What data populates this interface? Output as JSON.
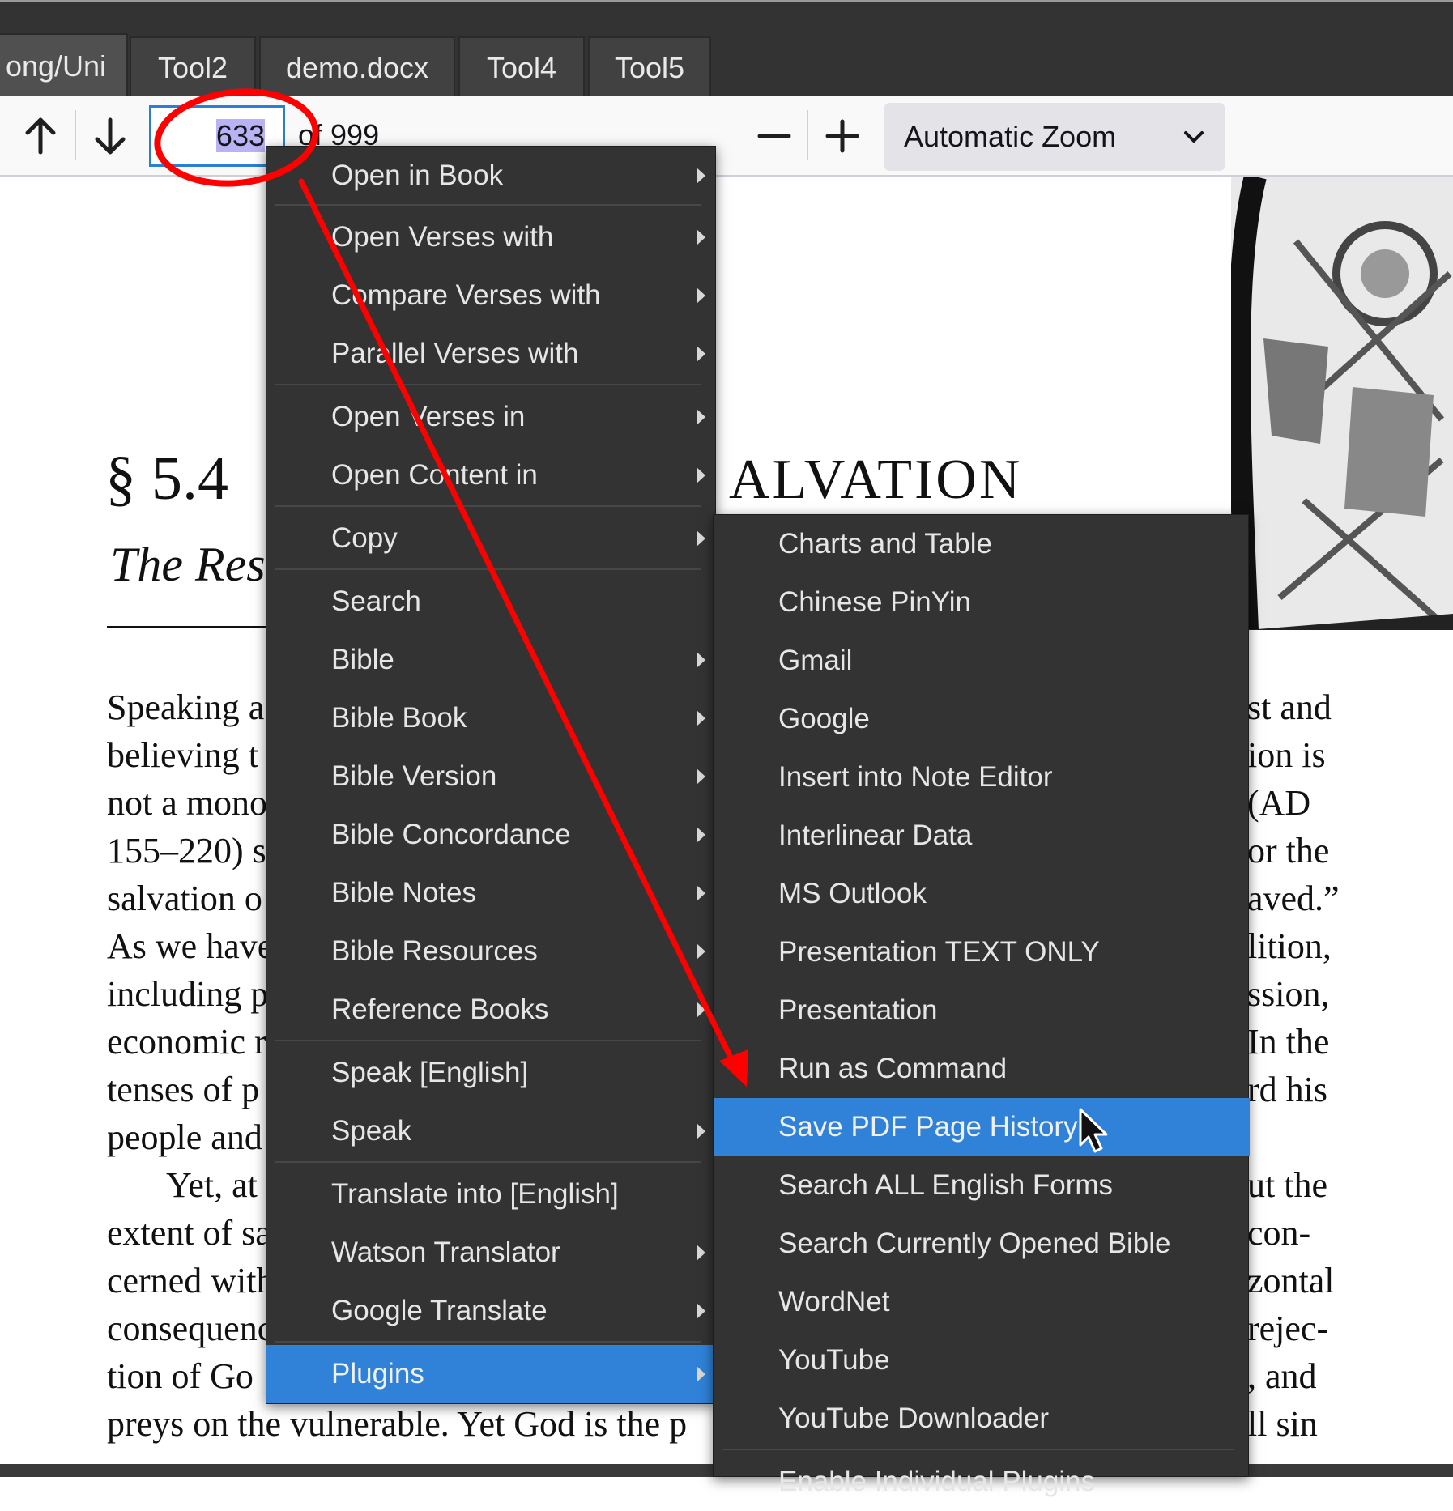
{
  "tabs": [
    {
      "label": "ong/Uni",
      "active": true
    },
    {
      "label": "Tool2"
    },
    {
      "label": "demo.docx"
    },
    {
      "label": "Tool4"
    },
    {
      "label": "Tool5"
    }
  ],
  "toolbar": {
    "page_number": "633",
    "page_total_label": "of 999",
    "zoom_label": "Automatic Zoom",
    "prev_icon": "arrow-up-icon",
    "next_icon": "arrow-down-icon",
    "zoom_out_icon": "minus-icon",
    "zoom_in_icon": "plus-icon"
  },
  "document": {
    "heading_left": "§ 5.4",
    "heading_right": "ALVATION",
    "subtitle": "The Res",
    "left_lines": [
      "Speaking a",
      "believing t",
      "not a mono",
      "155–220) s",
      "salvation o",
      "As we have",
      "including p",
      "economic r",
      "tenses of p",
      "people and",
      "Yet, at",
      "extent of sa",
      "cerned with",
      "consequenc",
      "tion of Go",
      "preys on the vulnerable. Yet God is the p"
    ],
    "right_lines": [
      "st and",
      "ion is",
      "(AD",
      "or the",
      "aved.”",
      "lition,",
      "ssion,",
      "In the",
      "rd his",
      "",
      "ut the",
      "con-",
      "zontal",
      "rejec-",
      ", and",
      "ll sin"
    ]
  },
  "context_menu": {
    "items": [
      {
        "label": "Open in Book",
        "submenu": true
      },
      {
        "label": "Open Verses with",
        "submenu": true
      },
      {
        "label": "Compare Verses with",
        "submenu": true
      },
      {
        "label": "Parallel Verses with",
        "submenu": true
      },
      {
        "label": "Open Verses in",
        "submenu": true
      },
      {
        "label": "Open Content in",
        "submenu": true
      },
      {
        "label": "Copy",
        "submenu": true
      },
      {
        "label": "Search",
        "submenu": false
      },
      {
        "label": "Bible",
        "submenu": true
      },
      {
        "label": "Bible Book",
        "submenu": true
      },
      {
        "label": "Bible Version",
        "submenu": true
      },
      {
        "label": "Bible Concordance",
        "submenu": true
      },
      {
        "label": "Bible Notes",
        "submenu": true
      },
      {
        "label": "Bible Resources",
        "submenu": true
      },
      {
        "label": "Reference Books",
        "submenu": true
      },
      {
        "label": "Speak [English]",
        "submenu": false
      },
      {
        "label": "Speak",
        "submenu": true
      },
      {
        "label": "Translate into [English]",
        "submenu": false
      },
      {
        "label": "Watson Translator",
        "submenu": true
      },
      {
        "label": "Google Translate",
        "submenu": true
      },
      {
        "label": "Plugins",
        "submenu": true,
        "selected": true
      }
    ]
  },
  "plugins_submenu": {
    "items": [
      {
        "label": "Charts and Table"
      },
      {
        "label": "Chinese PinYin"
      },
      {
        "label": "Gmail"
      },
      {
        "label": "Google"
      },
      {
        "label": "Insert into Note Editor"
      },
      {
        "label": "Interlinear Data"
      },
      {
        "label": "MS Outlook"
      },
      {
        "label": "Presentation TEXT ONLY"
      },
      {
        "label": "Presentation"
      },
      {
        "label": "Run as Command"
      },
      {
        "label": "Save PDF Page History",
        "selected": true
      },
      {
        "label": "Search ALL English Forms"
      },
      {
        "label": "Search Currently Opened Bible"
      },
      {
        "label": "WordNet"
      },
      {
        "label": "YouTube"
      },
      {
        "label": "YouTube Downloader"
      },
      {
        "label": "Enable Individual Plugins"
      }
    ]
  },
  "colors": {
    "menu_bg": "#333333",
    "menu_selected": "#2f82d8",
    "annotation_red": "#ff0000",
    "input_focus": "#2a7fd4"
  }
}
